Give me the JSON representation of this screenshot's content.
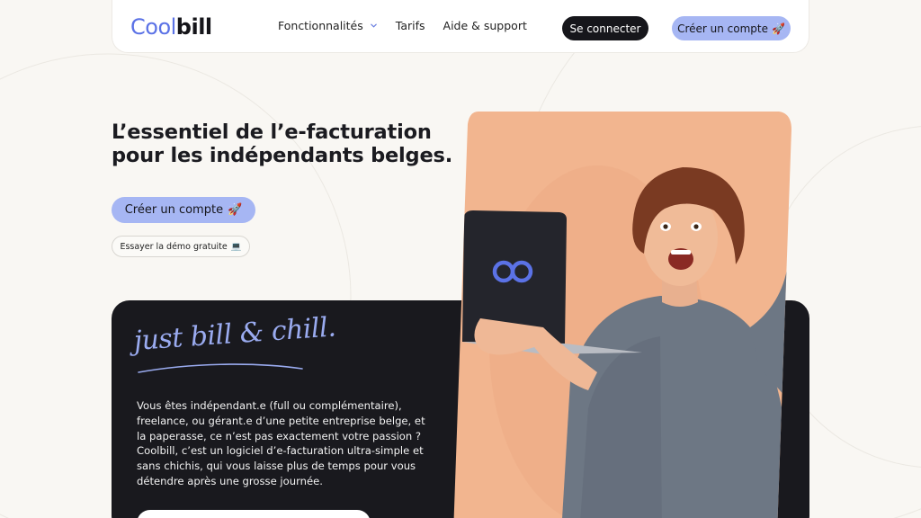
{
  "brand": {
    "logo_cool": "Cool",
    "logo_bill": "bill",
    "accent": "#5b72e6",
    "button_blue": "#a6b6f3",
    "dark": "#19191e",
    "peach": "#f2b58f"
  },
  "nav": {
    "items": [
      {
        "label": "Fonctionnalités",
        "has_dropdown": true,
        "icon": "chevron-down-icon"
      },
      {
        "label": "Tarifs"
      },
      {
        "label": "Aide & support"
      }
    ],
    "login_label": "Se connecter",
    "create_label": "Créer un compte",
    "create_icon": "🚀"
  },
  "hero": {
    "title_line1": "L’essentiel de l’e-facturation",
    "title_line2": "pour les indépendants belges.",
    "cta_label": "Créer un compte",
    "cta_icon": "🚀",
    "demo_label": "Essayer la démo gratuite",
    "demo_icon": "💻"
  },
  "card": {
    "tagline": "just bill & chill.",
    "description": "Vous êtes indépendant.e (full ou complémentaire), freelance, ou gérant.e d’une petite entreprise belge, et la paperasse, ce n’est pas exactement votre passion ? Coolbill, c’est un logiciel d’e-facturation ultra-simple et sans chichis, qui vous laisse plus de temps pour vous détendre après une grosse journée."
  },
  "photo": {
    "subject": "woman-holding-laptop",
    "laptop_logo_icon": "infinity-logo-icon"
  }
}
